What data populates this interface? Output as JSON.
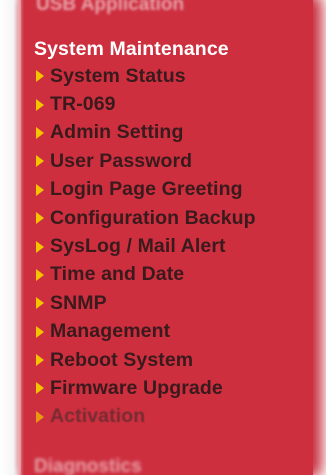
{
  "sidebar": {
    "previous_section": "USB Application",
    "section_title": "System Maintenance",
    "next_section": "Diagnostics",
    "items": [
      {
        "label": "System Status"
      },
      {
        "label": "TR-069"
      },
      {
        "label": "Admin Setting"
      },
      {
        "label": "User Password"
      },
      {
        "label": "Login Page Greeting"
      },
      {
        "label": "Configuration Backup"
      },
      {
        "label": "SysLog / Mail Alert"
      },
      {
        "label": "Time and Date"
      },
      {
        "label": "SNMP"
      },
      {
        "label": "Management"
      },
      {
        "label": "Reboot System"
      },
      {
        "label": "Firmware Upgrade"
      },
      {
        "label": "Activation"
      }
    ],
    "item_icon": "arrow-right-icon",
    "colors": {
      "panel": "#cd2f3f",
      "arrow": "#f5c400",
      "header_text": "#ffffff",
      "item_text": "#3a1a1c"
    }
  }
}
